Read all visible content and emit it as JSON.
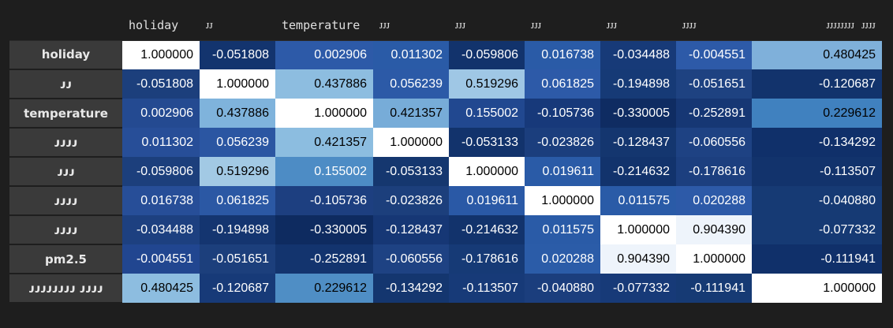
{
  "columns": [
    "holiday",
    "ᴊᴊ",
    "temperature",
    "ᴊᴊᴊ",
    "ᴊᴊᴊ",
    "ᴊᴊᴊ",
    "ᴊᴊᴊ",
    "ᴊᴊᴊᴊ",
    "ᴊᴊᴊᴊᴊᴊᴊᴊ ᴊᴊᴊᴊ"
  ],
  "rows": [
    {
      "label": "holiday",
      "values": [
        "1.000000",
        "-0.051808",
        "0.002906",
        "0.011302",
        "-0.059806",
        "0.016738",
        "-0.034488",
        "-0.004551",
        "0.480425"
      ],
      "colors": [
        "#ffffff",
        "#13346e",
        "#2d5aa8",
        "#2a5ba7",
        "#12336c",
        "#2a5ba7",
        "#173a78",
        "#2d5aa8",
        "#7fb0da"
      ],
      "text": [
        "#000000",
        "#ffffff",
        "#ffffff",
        "#ffffff",
        "#ffffff",
        "#ffffff",
        "#ffffff",
        "#ffffff",
        "#000000"
      ]
    },
    {
      "label": "ᴊᴊ",
      "values": [
        "-0.051808",
        "1.000000",
        "0.437886",
        "0.056239",
        "0.519296",
        "0.061825",
        "-0.194898",
        "-0.051651",
        "-0.120687"
      ],
      "colors": [
        "#1c3f7c",
        "#ffffff",
        "#8dbde0",
        "#2c5aa7",
        "#9fc7e5",
        "#2d5aa8",
        "#163a76",
        "#1e4281",
        "#12336c"
      ],
      "text": [
        "#ffffff",
        "#000000",
        "#000000",
        "#ffffff",
        "#000000",
        "#ffffff",
        "#ffffff",
        "#ffffff",
        "#ffffff"
      ]
    },
    {
      "label": "temperature",
      "values": [
        "0.002906",
        "0.437886",
        "1.000000",
        "0.421357",
        "0.155002",
        "-0.105736",
        "-0.330005",
        "-0.252891",
        "0.229612"
      ],
      "colors": [
        "#244a91",
        "#7fb3dc",
        "#ffffff",
        "#77acd8",
        "#214890",
        "#17397a",
        "#0f2c62",
        "#163774",
        "#4081bf"
      ],
      "text": [
        "#ffffff",
        "#000000",
        "#000000",
        "#000000",
        "#ffffff",
        "#ffffff",
        "#ffffff",
        "#ffffff",
        "#000000"
      ]
    },
    {
      "label": "ᴊᴊᴊᴊ",
      "values": [
        "0.011302",
        "0.056239",
        "0.421357",
        "1.000000",
        "-0.053133",
        "-0.023826",
        "-0.128437",
        "-0.060556",
        "-0.134292"
      ],
      "colors": [
        "#274e98",
        "#2b56a2",
        "#8cbde0",
        "#ffffff",
        "#12336c",
        "#1b3e7d",
        "#14366f",
        "#1e4283",
        "#10306a"
      ],
      "text": [
        "#ffffff",
        "#ffffff",
        "#000000",
        "#000000",
        "#ffffff",
        "#ffffff",
        "#ffffff",
        "#ffffff",
        "#ffffff"
      ]
    },
    {
      "label": "ᴊᴊᴊ",
      "values": [
        "-0.059806",
        "0.519296",
        "0.155002",
        "-0.053133",
        "1.000000",
        "0.019611",
        "-0.214632",
        "-0.178616",
        "-0.113507"
      ],
      "colors": [
        "#1c3f7c",
        "#a2c9e4",
        "#4d8cc5",
        "#15376f",
        "#ffffff",
        "#2a5ba7",
        "#12336c",
        "#1c3f7f",
        "#12336c"
      ],
      "text": [
        "#ffffff",
        "#000000",
        "#ffffff",
        "#ffffff",
        "#000000",
        "#ffffff",
        "#ffffff",
        "#ffffff",
        "#ffffff"
      ]
    },
    {
      "label": "ᴊᴊᴊᴊ",
      "values": [
        "0.016738",
        "0.061825",
        "-0.105736",
        "-0.023826",
        "0.019611",
        "1.000000",
        "0.011575",
        "0.020288",
        "-0.040880"
      ],
      "colors": [
        "#274e98",
        "#2b58a4",
        "#1d3f80",
        "#1c3f7c",
        "#2a59a6",
        "#ffffff",
        "#2a5ba7",
        "#2d5aa8",
        "#163a74"
      ],
      "text": [
        "#ffffff",
        "#ffffff",
        "#ffffff",
        "#ffffff",
        "#ffffff",
        "#000000",
        "#ffffff",
        "#ffffff",
        "#ffffff"
      ]
    },
    {
      "label": "ᴊᴊᴊᴊ",
      "values": [
        "-0.034488",
        "-0.194898",
        "-0.330005",
        "-0.128437",
        "-0.214632",
        "0.011575",
        "1.000000",
        "0.904390",
        "-0.077332"
      ],
      "colors": [
        "#1d4080",
        "#143570",
        "#0e2b60",
        "#163775",
        "#12336c",
        "#2a5ba7",
        "#ffffff",
        "#eef4fb",
        "#163a74"
      ],
      "text": [
        "#ffffff",
        "#ffffff",
        "#ffffff",
        "#ffffff",
        "#ffffff",
        "#ffffff",
        "#000000",
        "#000000",
        "#ffffff"
      ]
    },
    {
      "label": "pm2.5",
      "values": [
        "-0.004551",
        "-0.051651",
        "-0.252891",
        "-0.060556",
        "-0.178616",
        "0.020288",
        "0.904390",
        "1.000000",
        "-0.111941"
      ],
      "colors": [
        "#214690",
        "#1c3f7c",
        "#13346e",
        "#1e4283",
        "#163a76",
        "#2b5ca8",
        "#eef4fb",
        "#ffffff",
        "#10306a"
      ],
      "text": [
        "#ffffff",
        "#ffffff",
        "#ffffff",
        "#ffffff",
        "#ffffff",
        "#ffffff",
        "#000000",
        "#000000",
        "#ffffff"
      ]
    },
    {
      "label": "ᴊᴊᴊᴊᴊᴊᴊᴊ ᴊᴊᴊᴊ",
      "values": [
        "0.480425",
        "-0.120687",
        "0.229612",
        "-0.134292",
        "-0.113507",
        "-0.040880",
        "-0.077332",
        "-0.111941",
        "1.000000"
      ],
      "colors": [
        "#8dbde0",
        "#173a78",
        "#4f8ec5",
        "#14366f",
        "#173a78",
        "#1b3e7d",
        "#173a78",
        "#163a74",
        "#ffffff"
      ],
      "text": [
        "#000000",
        "#ffffff",
        "#000000",
        "#ffffff",
        "#ffffff",
        "#ffffff",
        "#ffffff",
        "#ffffff",
        "#000000"
      ]
    }
  ]
}
